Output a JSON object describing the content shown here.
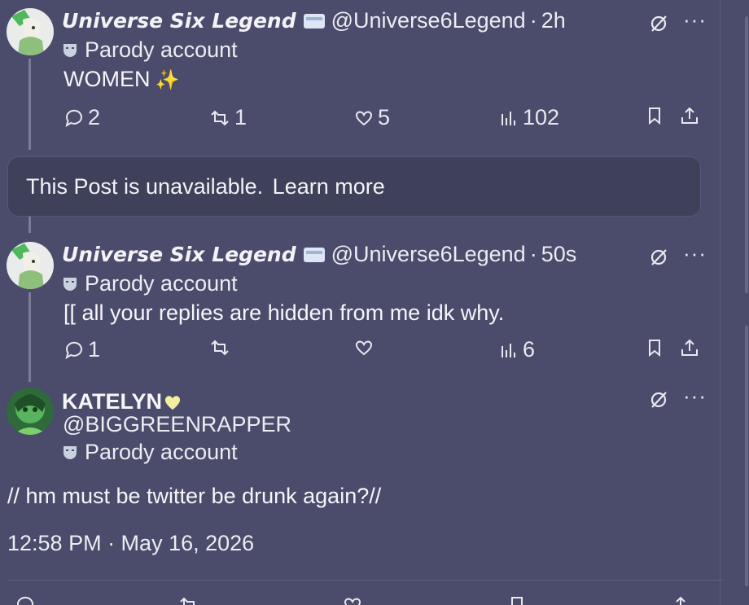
{
  "post1": {
    "name": "Universe Six Legend",
    "handle": "@Universe6Legend",
    "sep": "·",
    "time": "2h",
    "parody": "Parody account",
    "text": "WOMEN",
    "text_emoji": "✨",
    "replies": "2",
    "reposts": "1",
    "likes": "5",
    "views": "102"
  },
  "unavailable": {
    "text": "This Post is unavailable.",
    "link": "Learn more"
  },
  "post2": {
    "name": "Universe Six Legend",
    "handle": "@Universe6Legend",
    "sep": "·",
    "time": "50s",
    "parody": "Parody account",
    "text": "[[ all your replies are hidden from me idk why.",
    "replies": "1",
    "reposts": "",
    "likes": "",
    "views": "6"
  },
  "main": {
    "name": "KATELYN",
    "handle": "@BIGGREENRAPPER",
    "parody": "Parody account",
    "text": "// hm must be twitter be drunk again?//",
    "timestamp": "12:58 PM · May 16, 2026"
  },
  "icons": {
    "grok": "grok-slash-icon",
    "more": "more-dots-icon",
    "reply": "reply-bubble-icon",
    "repost": "repost-arrows-icon",
    "like": "heart-icon",
    "views": "views-bars-icon",
    "bookmark": "bookmark-icon",
    "share": "share-upload-icon",
    "parody": "parody-mask-icon",
    "verified": "card-badge-icon"
  },
  "colors": {
    "background": "#4b4c6b",
    "card": "#3f4059",
    "text": "#f3f3f7",
    "heart": "#f2f0a0"
  },
  "more_label": "···"
}
